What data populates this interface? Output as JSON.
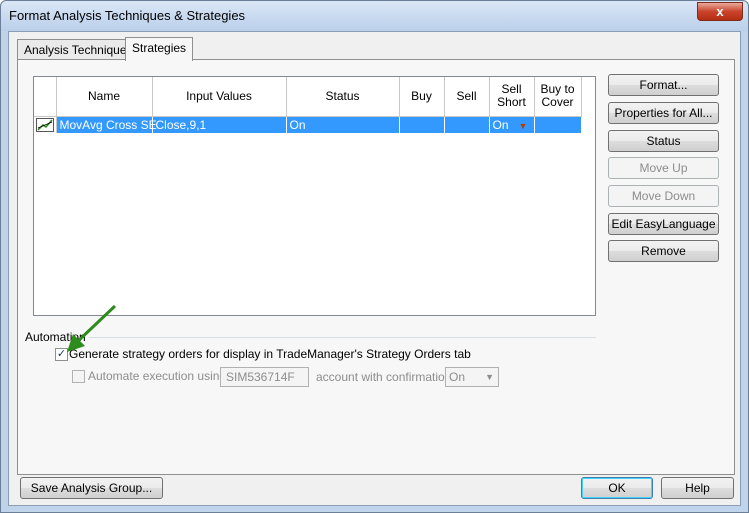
{
  "window": {
    "title": "Format Analysis Techniques & Strategies",
    "close_glyph": "x"
  },
  "tabs": [
    {
      "label": "Analysis Techniques",
      "active": false
    },
    {
      "label": "Strategies",
      "active": true
    }
  ],
  "grid": {
    "columns": [
      "",
      "Name",
      "Input Values",
      "Status",
      "Buy",
      "Sell",
      "Sell Short",
      "Buy to Cover"
    ],
    "rows": [
      {
        "icon": "strategy-chart-icon",
        "name": "MovAvg Cross SE",
        "input_values": "Close,9,1",
        "status": "On",
        "buy": "",
        "sell": "",
        "sell_short": "On",
        "buy_to_cover": "",
        "selected": true
      }
    ]
  },
  "side_buttons": [
    {
      "label": "Format...",
      "enabled": true
    },
    {
      "label": "Properties for All...",
      "enabled": true
    },
    {
      "label": "Status",
      "enabled": true
    },
    {
      "label": "Move Up",
      "enabled": false
    },
    {
      "label": "Move Down",
      "enabled": false
    },
    {
      "label": "Edit EasyLanguage",
      "enabled": true
    },
    {
      "label": "Remove",
      "enabled": true
    }
  ],
  "automation": {
    "group_label": "Automation",
    "generate_orders": {
      "label": "Generate strategy orders for display in TradeManager's Strategy Orders tab",
      "checked": true
    },
    "automate_execution": {
      "label": "Automate execution using",
      "checked": false,
      "enabled": false
    },
    "account": "SIM536714F",
    "confirmation_label": "account with confirmation",
    "confirmation_value": "On"
  },
  "footer": {
    "save_group": "Save Analysis Group...",
    "ok": "OK",
    "help": "Help"
  },
  "colors": {
    "selection": "#3399ff",
    "annotation_arrow": "#2e8b1e",
    "close_button": "#c9452c"
  }
}
